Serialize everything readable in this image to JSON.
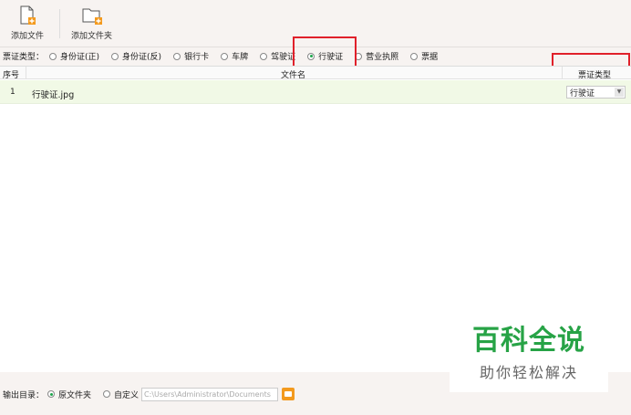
{
  "toolbar": {
    "add_file_label": "添加文件",
    "add_folder_label": "添加文件夹"
  },
  "ticket_type": {
    "label": "票证类型：",
    "options": [
      {
        "label": "身份证(正)",
        "selected": false
      },
      {
        "label": "身份证(反)",
        "selected": false
      },
      {
        "label": "银行卡",
        "selected": false
      },
      {
        "label": "车牌",
        "selected": false
      },
      {
        "label": "驾驶证",
        "selected": false
      },
      {
        "label": "行驶证",
        "selected": true
      },
      {
        "label": "营业执照",
        "selected": false
      },
      {
        "label": "票据",
        "selected": false
      }
    ]
  },
  "table": {
    "columns": [
      "序号",
      "文件名",
      "票证类型"
    ],
    "rows": [
      {
        "index": "1",
        "filename": "行驶证.jpg",
        "type": "行驶证"
      }
    ]
  },
  "output": {
    "label": "输出目录：",
    "option_source": "原文件夹",
    "option_custom": "自定义",
    "source_selected": true,
    "path_value": "C:\\Users\\Administrator\\Documents"
  },
  "watermark": {
    "title": "百科全说",
    "subtitle": "助你轻松解决"
  },
  "colors": {
    "highlight": "#e0202a",
    "accent_green": "#1ea44a",
    "row_bg": "#f1f9e6",
    "folder_orange": "#f39a1e"
  }
}
